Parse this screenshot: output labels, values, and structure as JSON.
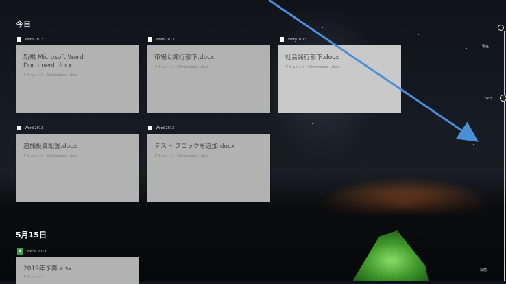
{
  "sections": {
    "today": "今日",
    "date2": "5月15日"
  },
  "cards": [
    {
      "app": "Word 2013",
      "name": "新規 Microsoft Word Document.docx",
      "path": "ドキュメント › Downloads › docs"
    },
    {
      "app": "Word 2013",
      "name": "市場と発行部下.docx",
      "path": "ドキュメント › Downloads › docs"
    },
    {
      "app": "Word 2013",
      "name": "社会発行部下.docx",
      "path": "ドキュメント › Downloads › docs"
    },
    {
      "app": "Word 2013",
      "name": "追加投資配置.docx",
      "path": "ドキュメント › Downloads › docs"
    },
    {
      "app": "Word 2013",
      "name": "テスト ブロックを追加.docx",
      "path": "ドキュメント › Downloads › docs"
    },
    {
      "app": "Excel 2013",
      "name": "2019年予算.xlsx",
      "path": "ドキュメント"
    }
  ],
  "timeline": {
    "top_label": "現在",
    "mid_label": "今日",
    "bottom_label": "以前"
  },
  "colors": {
    "card": "#b2b2b2",
    "card_light": "#c9c9c9",
    "arrow": "#4a90d9",
    "excel": "#3f9b50"
  },
  "icons": {
    "doc": "document-icon",
    "excel": "excel-icon",
    "search": "search-icon"
  }
}
